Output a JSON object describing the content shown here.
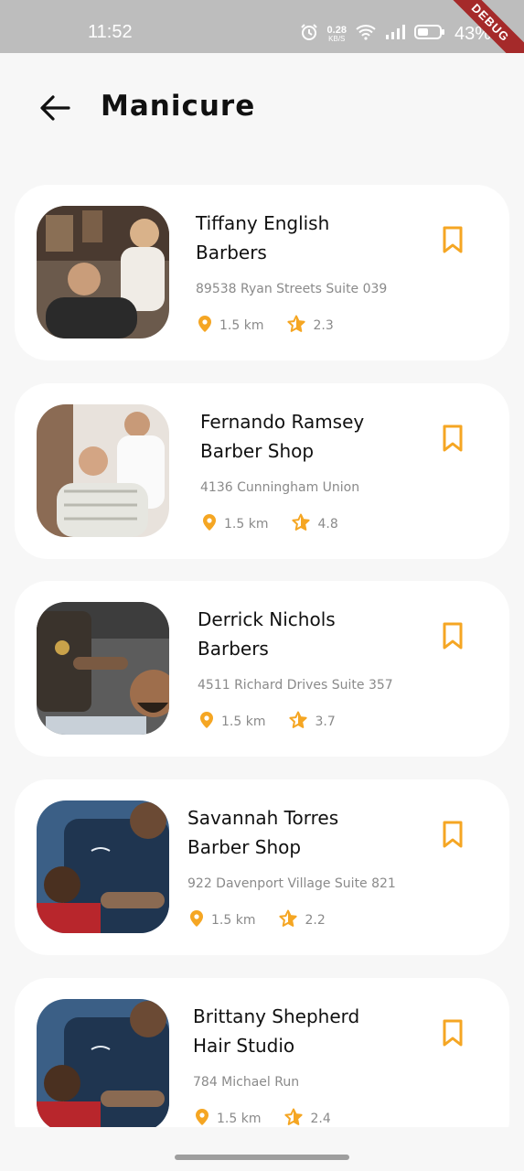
{
  "status_bar": {
    "time": "11:52",
    "network_speed": "0.28",
    "network_unit": "KB/S",
    "battery": "43%",
    "debug_banner": "DEBUG"
  },
  "header": {
    "back_icon": "arrow-left-icon",
    "title": "Manicure"
  },
  "colors": {
    "accent": "#f5a623",
    "background": "#f7f7f7",
    "card": "#ffffff"
  },
  "shops": [
    {
      "name_line1": "Tiffany English",
      "name_line2": "Barbers",
      "address": "89538 Ryan Streets Suite 039",
      "distance": "1.5 km",
      "rating": "2.3"
    },
    {
      "name_line1": "Fernando Ramsey",
      "name_line2": "Barber Shop",
      "address": "4136 Cunningham Union",
      "distance": "1.5 km",
      "rating": "4.8"
    },
    {
      "name_line1": "Derrick Nichols",
      "name_line2": "Barbers",
      "address": "4511 Richard Drives Suite 357",
      "distance": "1.5 km",
      "rating": "3.7"
    },
    {
      "name_line1": "Savannah Torres",
      "name_line2": "Barber Shop",
      "address": "922 Davenport Village Suite 821",
      "distance": "1.5 km",
      "rating": "2.2"
    },
    {
      "name_line1": "Brittany Shepherd",
      "name_line2": "Hair Studio",
      "address": "784 Michael Run",
      "distance": "1.5 km",
      "rating": "2.4"
    }
  ]
}
